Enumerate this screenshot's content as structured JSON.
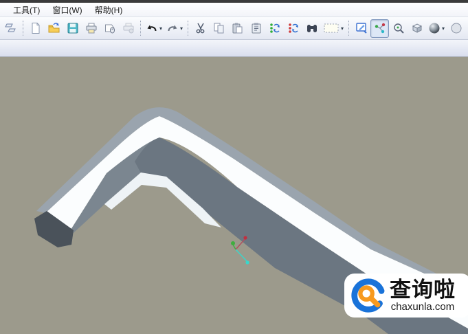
{
  "menu_bar": {
    "items": [
      {
        "id": "tools",
        "label": "工具(T)"
      },
      {
        "id": "window",
        "label": "窗口(W)"
      },
      {
        "id": "help",
        "label": "帮助(H)"
      }
    ]
  },
  "toolbar": {
    "buttons": [
      {
        "name": "model-tree",
        "icon": "model-tree"
      },
      {
        "sep": true
      },
      {
        "name": "new-file",
        "icon": "new-file"
      },
      {
        "name": "open-file",
        "icon": "open-folder"
      },
      {
        "name": "save",
        "icon": "save"
      },
      {
        "name": "print",
        "icon": "print"
      },
      {
        "name": "print-preview",
        "icon": "print-preview"
      },
      {
        "name": "print-setup",
        "icon": "print-setup",
        "disabled": true
      },
      {
        "sep": true
      },
      {
        "name": "undo",
        "icon": "undo",
        "dropdown": true
      },
      {
        "name": "redo",
        "icon": "redo",
        "dropdown": true
      },
      {
        "sep": true
      },
      {
        "name": "cut",
        "icon": "cut"
      },
      {
        "name": "copy",
        "icon": "copy"
      },
      {
        "name": "paste",
        "icon": "paste"
      },
      {
        "name": "paste-special",
        "icon": "paste-special"
      },
      {
        "name": "regenerate",
        "icon": "regenerate-green"
      },
      {
        "name": "regenerate-failed",
        "icon": "regenerate-red"
      },
      {
        "name": "find",
        "icon": "binoculars"
      },
      {
        "name": "selection-filter",
        "icon": "selection-box",
        "dropdown": true
      },
      {
        "sep": true
      },
      {
        "name": "repaint",
        "icon": "repaint"
      },
      {
        "name": "spin-center",
        "icon": "spin-center",
        "pressed": true
      },
      {
        "name": "orient-mode",
        "icon": "orient"
      },
      {
        "name": "saved-views",
        "icon": "saved-views"
      },
      {
        "name": "display-style",
        "icon": "sphere",
        "dropdown": true
      },
      {
        "name": "clipped-button",
        "icon": "sphere-outline"
      }
    ]
  },
  "viewport": {
    "background": "#9c9a8c",
    "model": "hex-key-allen-wrench-3d",
    "colors": {
      "top_facet": "#9aa4ae",
      "white_facet": "#fbfdfe",
      "dark_facet": "#6b7681",
      "side_facet": "#7b8690",
      "inner_highlight": "#eef3f6",
      "end_cap": "#4a525a"
    },
    "spin_center": {
      "red": "#c03040",
      "green": "#3fae3f",
      "cyan": "#38d8cc",
      "stem": "#b05060"
    }
  },
  "watermark": {
    "brand": "查询啦",
    "domain": "chaxunla.com",
    "ring_color": "#1a73d9",
    "magnifier_color": "#f79a1f"
  }
}
